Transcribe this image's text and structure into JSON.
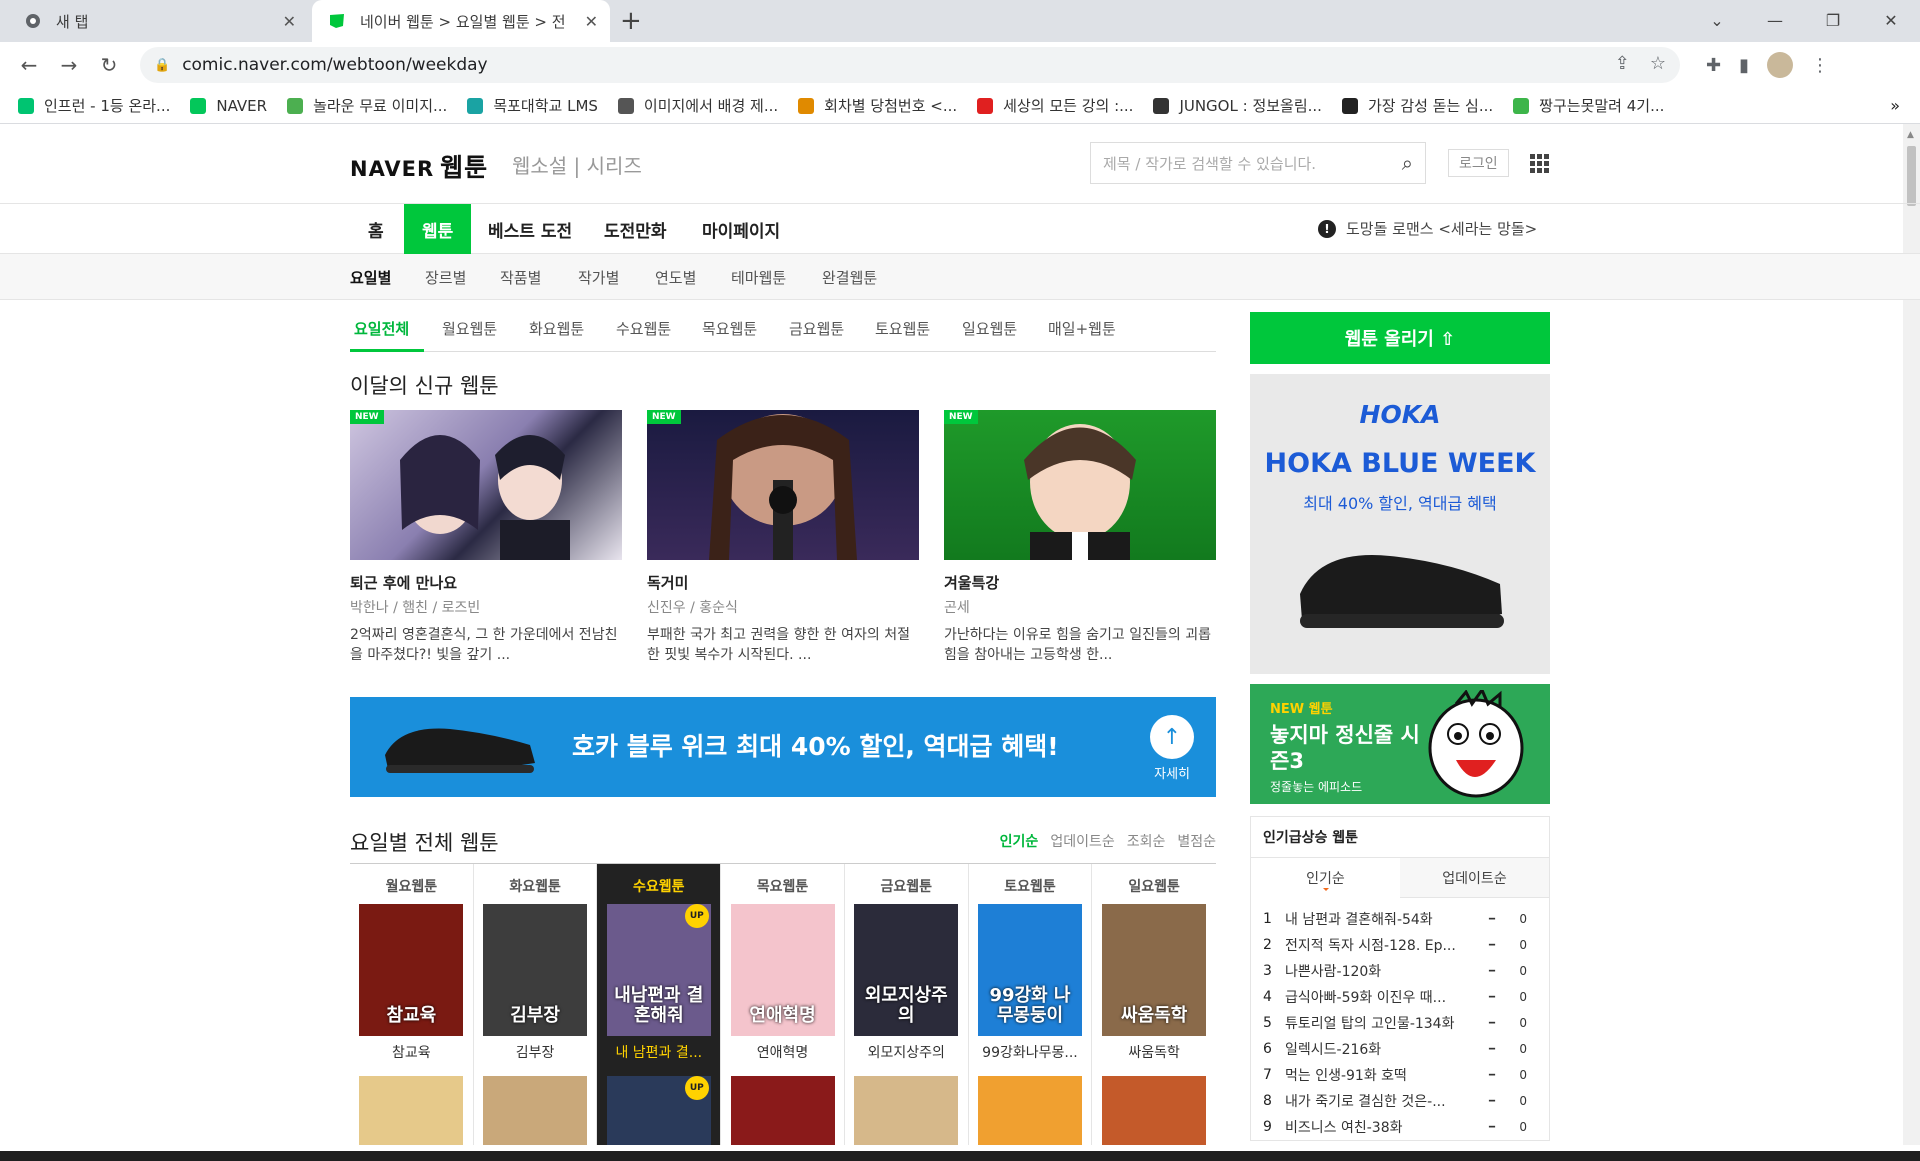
{
  "browser": {
    "tabs": [
      {
        "title": "새 탭",
        "active": false
      },
      {
        "title": "네이버 웹툰 > 요일별 웹툰 > 전",
        "active": true
      }
    ],
    "new_tab": "+",
    "url": "comic.naver.com/webtoon/weekday",
    "bookmarks": [
      {
        "label": "인프런 - 1등 온라...",
        "color": "#00c471",
        "icon": "inflearn-icon"
      },
      {
        "label": "NAVER",
        "color": "#03c75a",
        "icon": "naver-icon"
      },
      {
        "label": "놀라운 무료 이미지...",
        "color": "#4caf50",
        "icon": "pixabay-icon"
      },
      {
        "label": "목포대학교 LMS",
        "color": "#1aa3a3",
        "icon": "lms-icon"
      },
      {
        "label": "이미지에서 배경 제...",
        "color": "#555555",
        "icon": "layers-icon"
      },
      {
        "label": "회차별 당첨번호 <...",
        "color": "#e08a00",
        "icon": "lotto-icon"
      },
      {
        "label": "세상의 모든 강의 :...",
        "color": "#e02020",
        "icon": "play-icon"
      },
      {
        "label": "JUNGOL : 정보올림...",
        "color": "#333333",
        "icon": "jungol-icon"
      },
      {
        "label": "가장 감성 돋는 심...",
        "color": "#222222",
        "icon": "dots-icon"
      },
      {
        "label": "짱구는못말려 4기...",
        "color": "#3db54a",
        "icon": "line-icon"
      }
    ],
    "bookmarks_more": "»"
  },
  "header": {
    "logo": "NAVER",
    "logo_webtoon": "웹툰",
    "sub_links": "웹소설 | 시리즈",
    "search_placeholder": "제목 / 작가로 검색할 수 있습니다.",
    "login": "로그인"
  },
  "gnb": {
    "items": [
      "홈",
      "웹툰",
      "베스트 도전",
      "도전만화",
      "마이페이지"
    ],
    "active": "웹툰",
    "notice": "도망돌 로맨스 <세라는 망돌>"
  },
  "lnb": {
    "items": [
      "요일별",
      "장르별",
      "작품별",
      "작가별",
      "연도별",
      "테마웹툰",
      "완결웹툰"
    ],
    "active": "요일별"
  },
  "day_tabs": [
    "요일전체",
    "월요웹툰",
    "화요웹툰",
    "수요웹툰",
    "목요웹툰",
    "금요웹툰",
    "토요웹툰",
    "일요웹툰",
    "매일+웹툰"
  ],
  "new_section": {
    "title": "이달의 신규 웹툰",
    "badge": "NEW",
    "items": [
      {
        "title": "퇴근 후에 만나요",
        "author": "박한나 / 햄친 / 로즈빈",
        "desc": "2억짜리 영혼결혼식, 그 한 가운데에서 전남친을 마주쳤다?! 빛을 갚기 ..."
      },
      {
        "title": "독거미",
        "author": "신진우 / 홍순식",
        "desc": "부패한 국가 최고 권력을 향한 한 여자의 처절한 핏빛 복수가 시작된다. ..."
      },
      {
        "title": "겨울특강",
        "author": "곤세",
        "desc": "가난하다는 이유로 힘을 숨기고 일진들의 괴롭힘을 참아내는 고등학생 한..."
      }
    ]
  },
  "banner": {
    "text": "호카 블루 위크 최대 40% 할인, 역대급 혜택!",
    "more": "자세히"
  },
  "all_section": {
    "title": "요일별 전체 웹툰",
    "sorts": [
      "인기순",
      "업데이트순",
      "조회순",
      "별점순"
    ],
    "active_sort": "인기순",
    "up_badge": "UP",
    "columns": [
      {
        "day": "월요웹툰",
        "title": "참교육",
        "thumb_text": "참교육",
        "color": "#7a1a12"
      },
      {
        "day": "화요웹툰",
        "title": "김부장",
        "thumb_text": "김부장",
        "color": "#3d3d3d"
      },
      {
        "day": "수요웹툰",
        "title": "내 남편과 결...",
        "thumb_text": "내남편과 결혼해줘",
        "color": "#6b5a8c",
        "today": true
      },
      {
        "day": "목요웹툰",
        "title": "연애혁명",
        "thumb_text": "연애혁명",
        "color": "#f4c4cc"
      },
      {
        "day": "금요웹툰",
        "title": "외모지상주의",
        "thumb_text": "외모지상주의",
        "color": "#2b2b3a"
      },
      {
        "day": "토요웹툰",
        "title": "99강화나무몽...",
        "thumb_text": "99강화 나무몽둥이",
        "color": "#1e7fd6"
      },
      {
        "day": "일요웹툰",
        "title": "싸움독학",
        "thumb_text": "싸움독학",
        "color": "#8a6a4a"
      }
    ]
  },
  "side": {
    "upload": "웹툰 올리기 ⇧",
    "ad1": {
      "brand": "HOKA",
      "head": "HOKA BLUE WEEK",
      "sub": "최대 40% 할인, 역대급 혜택"
    },
    "ad2": {
      "new": "NEW 웹툰",
      "title": "놓지마 정신줄 시즌3",
      "small": "정줄놓는 에피소드"
    },
    "rank": {
      "title": "인기급상승 웹툰",
      "tabs": [
        "인기순",
        "업데이트순"
      ],
      "items": [
        {
          "n": "1",
          "t": "내 남편과 결혼해줘-54화",
          "c": "0"
        },
        {
          "n": "2",
          "t": "전지적 독자 시점-128. Ep...",
          "c": "0"
        },
        {
          "n": "3",
          "t": "나쁜사람-120화",
          "c": "0"
        },
        {
          "n": "4",
          "t": "급식아빠-59화 이진우 때...",
          "c": "0"
        },
        {
          "n": "5",
          "t": "튜토리얼 탑의 고인물-134화",
          "c": "0"
        },
        {
          "n": "6",
          "t": "일렉시드-216화",
          "c": "0"
        },
        {
          "n": "7",
          "t": "먹는 인생-91화 호떡",
          "c": "0"
        },
        {
          "n": "8",
          "t": "내가 죽기로 결심한 것은-...",
          "c": "0"
        },
        {
          "n": "9",
          "t": "비즈니스 여친-38화",
          "c": "0"
        }
      ]
    }
  }
}
